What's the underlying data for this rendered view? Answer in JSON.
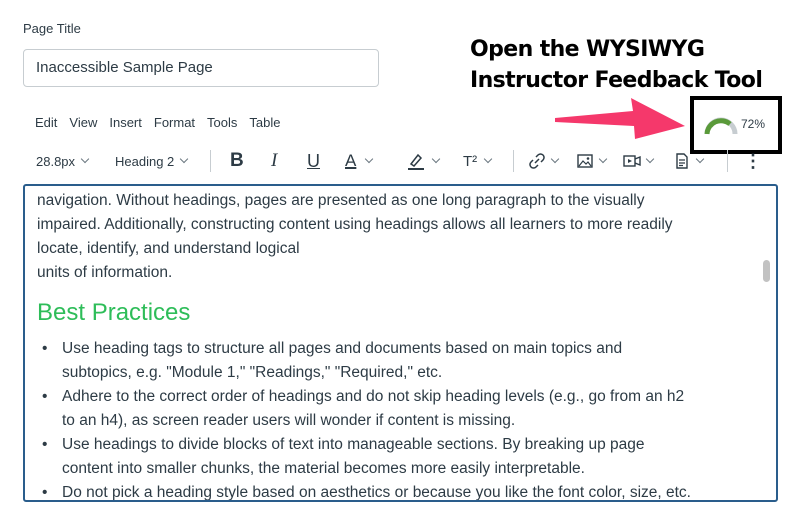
{
  "page_title_label": "Page Title",
  "page_title_value": "Inaccessible Sample Page",
  "annotation": {
    "line1": "Open the WYSIWYG",
    "line2": "Instructor Feedback Tool",
    "arrow_color": "#f5386b"
  },
  "menu": [
    "Edit",
    "View",
    "Insert",
    "Format",
    "Tools",
    "Table"
  ],
  "accessibility_checker": {
    "score_label": "72%",
    "score": 72,
    "gauge_color": "#5a9a3a"
  },
  "toolbar": {
    "font_size": "28.8px",
    "block_format": "Heading 2",
    "bold": "B",
    "italic": "I",
    "underline": "U",
    "text_color": "A",
    "superscript": "T²",
    "more": "⋮"
  },
  "editor": {
    "intro_lines": [
      "navigation. Without headings, pages are presented as one long paragraph to the visually",
      "impaired.   Additionally, constructing content using headings allows all learners to more readily",
      "locate, identify, and understand logical",
      "units of information."
    ],
    "heading": "Best Practices",
    "heading_color": "#2ebd59",
    "bullets": [
      [
        "Use heading tags to structure all pages and documents based on main topics and",
        "subtopics, e.g. \"Module 1,\" \"Readings,\" \"Required,\" etc."
      ],
      [
        "Adhere to the correct order of headings and do not skip heading levels (e.g., go from an h2",
        "to an h4), as screen reader users will wonder if content is missing."
      ],
      [
        "Use headings to divide blocks of text into manageable sections. By breaking up page",
        "content into smaller chunks, the material becomes more easily interpretable."
      ],
      [
        "Do not pick a heading style based on aesthetics or because you like the font color, size, etc."
      ]
    ]
  }
}
